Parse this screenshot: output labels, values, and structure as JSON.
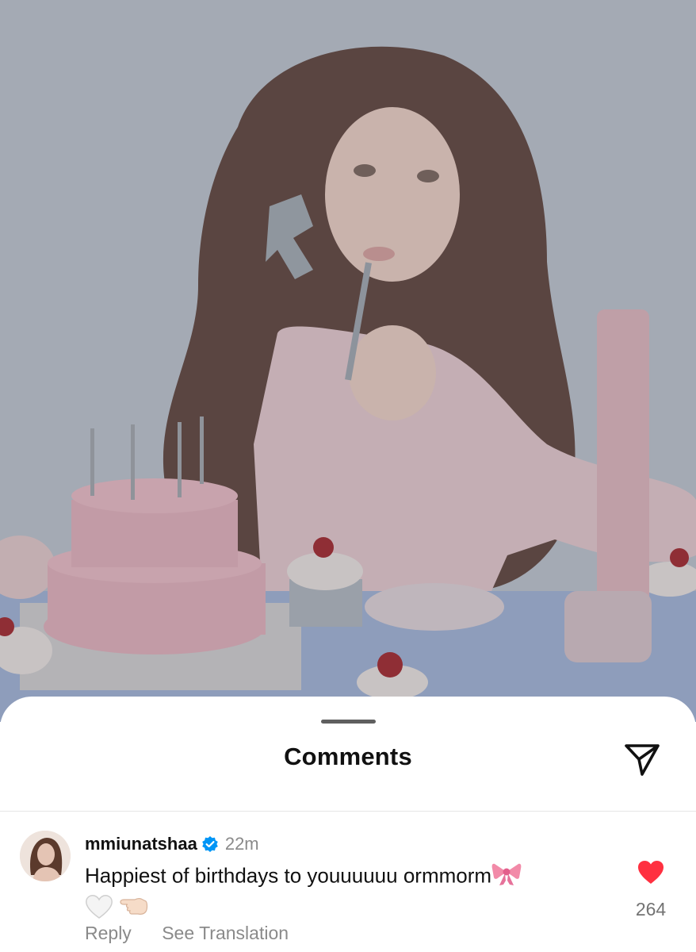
{
  "sheet": {
    "title": "Comments"
  },
  "comment": {
    "username": "mmiunatshaa",
    "verified": true,
    "timestamp": "22m",
    "text": "Happiest of birthdays to youuuuuu ormmorm",
    "emojis": [
      "ribbon-emoji",
      "white-heart-emoji",
      "pointing-left-hand-emoji"
    ],
    "reply_label": "Reply",
    "translate_label": "See Translation",
    "like_count": "264",
    "liked": true
  },
  "colors": {
    "verified_badge": "#0095f6",
    "liked_heart": "#ff3040",
    "photo_backdrop": "#a3a9b3"
  },
  "icons": {
    "share": "paper-plane-icon",
    "like": "heart-icon",
    "verified": "verified-badge-icon"
  }
}
